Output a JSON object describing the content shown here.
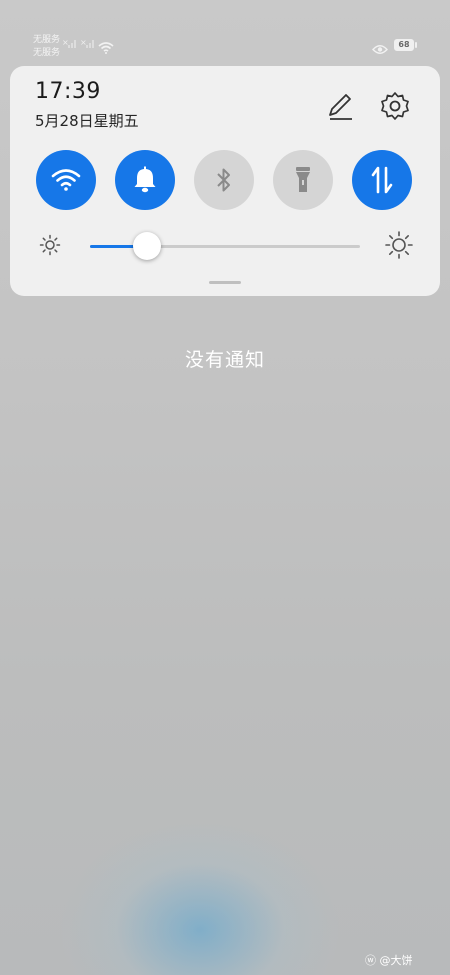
{
  "status_bar": {
    "carrier_1": "无服务",
    "carrier_2": "无服务",
    "battery_level": "68",
    "icons": [
      "signal-icon",
      "signal-icon",
      "wifi-icon",
      "eye-icon",
      "battery-icon"
    ]
  },
  "quick_panel": {
    "time": "17:39",
    "date": "5月28日星期五",
    "actions": [
      "edit-icon",
      "gear-icon"
    ],
    "toggles": [
      {
        "name": "wifi",
        "icon": "wifi-icon",
        "state": "on"
      },
      {
        "name": "sound",
        "icon": "bell-icon",
        "state": "on"
      },
      {
        "name": "bluetooth",
        "icon": "bluetooth-icon",
        "state": "off"
      },
      {
        "name": "flashlight",
        "icon": "flashlight-icon",
        "state": "off"
      },
      {
        "name": "mobile-data",
        "icon": "data-arrows-icon",
        "state": "on"
      }
    ],
    "brightness_fraction": 0.21
  },
  "notifications": {
    "empty_text": "没有通知"
  },
  "watermark": "@大饼",
  "colors": {
    "accent": "#1677e8",
    "panel": "#f0f0f0",
    "toggle_off": "#d5d5d5"
  }
}
